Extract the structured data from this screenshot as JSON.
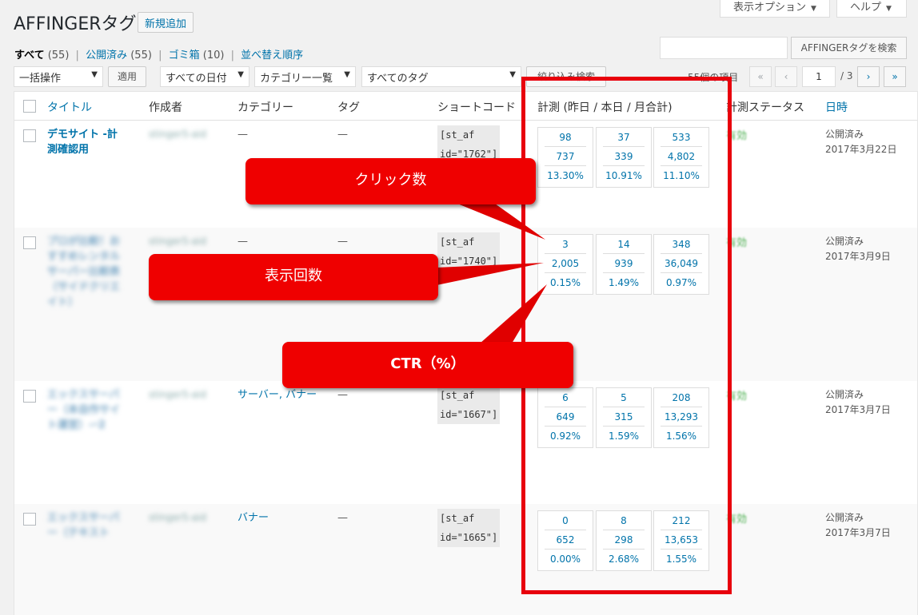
{
  "header": {
    "title": "AFFINGERタグ",
    "add_new": "新規追加",
    "screen_options": "表示オプション",
    "help": "ヘルプ"
  },
  "filters": {
    "all": "すべて",
    "all_count": "(55)",
    "published": "公開済み",
    "published_count": "(55)",
    "trash": "ゴミ箱",
    "trash_count": "(10)",
    "sort": "並べ替え順序"
  },
  "search": {
    "value": "",
    "button": "AFFINGERタグを検索"
  },
  "toolbar": {
    "bulk_action": "一括操作",
    "apply": "適用",
    "all_dates": "すべての日付",
    "category_list": "カテゴリー一覧",
    "all_tags": "すべてのタグ",
    "filter_button": "絞り込み検索",
    "items_count": "55個の項目",
    "first": "«",
    "prev": "‹",
    "current_page": "1",
    "total_pages": "/ 3",
    "next": "›",
    "last": "»"
  },
  "columns": {
    "title": "タイトル",
    "author": "作成者",
    "category": "カテゴリー",
    "tag": "タグ",
    "shortcode": "ショートコード",
    "metrics": "計測 (昨日 / 本日 / 月合計)",
    "status": "計測ステータス",
    "date": "日時"
  },
  "rows": [
    {
      "title": "デモサイト -計測確認用",
      "title_blurred": false,
      "author": "stinger5-aid",
      "category": "—",
      "category_link": false,
      "tag": "—",
      "shortcode": "[st_af\nid=\"1762\"]",
      "metrics": [
        [
          "98",
          "737",
          "13.30%"
        ],
        [
          "37",
          "339",
          "10.91%"
        ],
        [
          "533",
          "4,802",
          "11.10%"
        ]
      ],
      "status": "有効",
      "date_status": "公開済み",
      "date": "2017年3月22日"
    },
    {
      "title": "プロが比較！おすすめレンタルサーバー比較表（サイドクリエイト）",
      "title_blurred": true,
      "author": "stinger5-aid",
      "category": "—",
      "category_link": false,
      "tag": "—",
      "shortcode": "[st_af\nid=\"1740\"]",
      "metrics": [
        [
          "3",
          "2,005",
          "0.15%"
        ],
        [
          "14",
          "939",
          "1.49%"
        ],
        [
          "348",
          "36,049",
          "0.97%"
        ]
      ],
      "status": "有効",
      "date_status": "公開済み",
      "date": "2017年3月9日"
    },
    {
      "title": "エックスサーバー（本自作サイト運営）-ｰ2",
      "title_blurred": true,
      "author": "stinger5-aid",
      "category": "サーバー, バナー",
      "category_link": true,
      "tag": "—",
      "shortcode": "[st_af\nid=\"1667\"]",
      "metrics": [
        [
          "6",
          "649",
          "0.92%"
        ],
        [
          "5",
          "315",
          "1.59%"
        ],
        [
          "208",
          "13,293",
          "1.56%"
        ]
      ],
      "status": "有効",
      "date_status": "公開済み",
      "date": "2017年3月7日"
    },
    {
      "title": "エックスサーバー（テキスト",
      "title_blurred": true,
      "author": "stinger5-aid",
      "category": "バナー",
      "category_link": true,
      "tag": "—",
      "shortcode": "[st_af\nid=\"1665\"]",
      "metrics": [
        [
          "0",
          "652",
          "0.00%"
        ],
        [
          "8",
          "298",
          "2.68%"
        ],
        [
          "212",
          "13,653",
          "1.55%"
        ]
      ],
      "status": "有効",
      "date_status": "公開済み",
      "date": "2017年3月7日"
    }
  ],
  "annotations": {
    "clicks": "クリック数",
    "impressions": "表示回数",
    "ctr": "CTR（%）"
  },
  "colors": {
    "accent": "#0073aa",
    "annotation_red": "#ef0000",
    "highlight_border": "#e8000d",
    "status_green": "#4caf50"
  }
}
